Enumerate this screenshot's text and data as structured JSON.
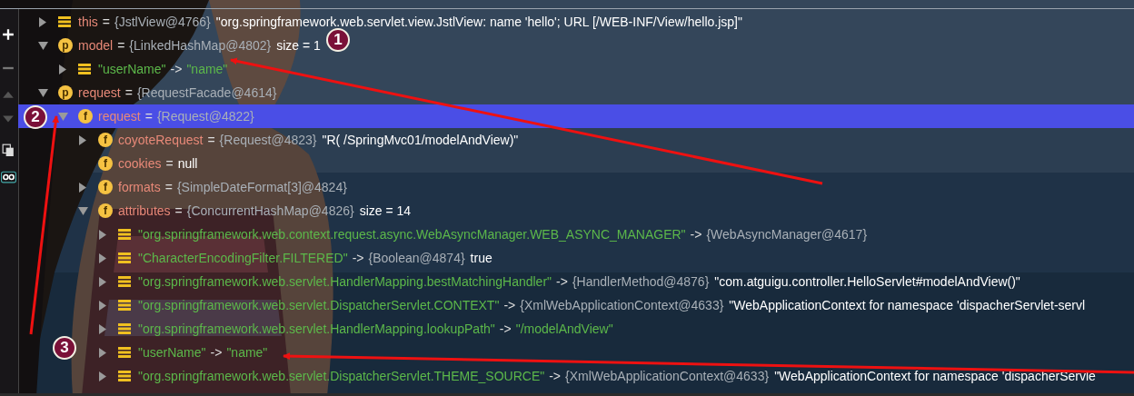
{
  "variables": [
    {
      "kind": "entry",
      "expandable": true,
      "expanded": false,
      "selected": false,
      "name": "this",
      "sep": "=",
      "type": "{JstlView@4766}",
      "value": "\"org.springframework.web.servlet.view.JstlView: name 'hello'; URL [/WEB-INF/View/hello.jsp]\"",
      "literal": false
    },
    {
      "kind": "param",
      "badge": "p",
      "expandable": true,
      "expanded": true,
      "selected": false,
      "name": "model",
      "sep": "=",
      "type": "{LinkedHashMap@4802}",
      "value": "size = 1",
      "literal": false,
      "children": [
        {
          "kind": "entry",
          "expandable": true,
          "expanded": false,
          "selected": false,
          "key": "\"userName\"",
          "sep": "->",
          "value": "\"name\"",
          "literal": true
        }
      ]
    },
    {
      "kind": "param",
      "badge": "p",
      "expandable": true,
      "expanded": true,
      "selected": false,
      "name": "request",
      "sep": "=",
      "type": "{RequestFacade@4614}",
      "children": [
        {
          "kind": "field",
          "badge": "f",
          "expandable": true,
          "expanded": true,
          "selected": true,
          "name": "request",
          "sep": "=",
          "type": "{Request@4822}",
          "children": [
            {
              "kind": "field",
              "badge": "f",
              "expandable": true,
              "expanded": false,
              "selected": false,
              "name": "coyoteRequest",
              "sep": "=",
              "type": "{Request@4823}",
              "value": "\"R( /SpringMvc01/modelAndView)\"",
              "literal": false
            },
            {
              "kind": "field",
              "badge": "f",
              "expandable": false,
              "expanded": false,
              "selected": false,
              "name": "cookies",
              "sep": "=",
              "value": "null",
              "literal": false
            },
            {
              "kind": "field",
              "badge": "f",
              "expandable": true,
              "expanded": false,
              "selected": false,
              "name": "formats",
              "sep": "=",
              "type": "{SimpleDateFormat[3]@4824}"
            },
            {
              "kind": "field",
              "badge": "f",
              "expandable": true,
              "expanded": true,
              "selected": false,
              "name": "attributes",
              "sep": "=",
              "type": "{ConcurrentHashMap@4826}",
              "value": "size = 14",
              "literal": false,
              "children": [
                {
                  "kind": "entry",
                  "expandable": true,
                  "expanded": false,
                  "selected": false,
                  "key": "\"org.springframework.web.context.request.async.WebAsyncManager.WEB_ASYNC_MANAGER\"",
                  "sep": "->",
                  "type": "{WebAsyncManager@4617}"
                },
                {
                  "kind": "entry",
                  "expandable": true,
                  "expanded": false,
                  "selected": false,
                  "key": "\"CharacterEncodingFilter.FILTERED\"",
                  "sep": "->",
                  "type": "{Boolean@4874}",
                  "value": "true",
                  "literal": false
                },
                {
                  "kind": "entry",
                  "expandable": true,
                  "expanded": false,
                  "selected": false,
                  "key": "\"org.springframework.web.servlet.HandlerMapping.bestMatchingHandler\"",
                  "sep": "->",
                  "type": "{HandlerMethod@4876}",
                  "value": "\"com.atguigu.controller.HelloServlet#modelAndView()\"",
                  "literal": false
                },
                {
                  "kind": "entry",
                  "expandable": true,
                  "expanded": false,
                  "selected": false,
                  "key": "\"org.springframework.web.servlet.DispatcherServlet.CONTEXT\"",
                  "sep": "->",
                  "type": "{XmlWebApplicationContext@4633}",
                  "value": "\"WebApplicationContext for namespace 'dispacherServlet-servl",
                  "literal": false
                },
                {
                  "kind": "entry",
                  "expandable": true,
                  "expanded": false,
                  "selected": false,
                  "key": "\"org.springframework.web.servlet.HandlerMapping.lookupPath\"",
                  "sep": "->",
                  "value": "\"/modelAndView\"",
                  "literal": true
                },
                {
                  "kind": "entry",
                  "expandable": true,
                  "expanded": false,
                  "selected": false,
                  "key": "\"userName\"",
                  "sep": "->",
                  "value": "\"name\"",
                  "literal": true
                },
                {
                  "kind": "entry",
                  "expandable": true,
                  "expanded": false,
                  "selected": false,
                  "key": "\"org.springframework.web.servlet.DispatcherServlet.THEME_SOURCE\"",
                  "sep": "->",
                  "type": "{XmlWebApplicationContext@4633}",
                  "value": "\"WebApplicationContext for namespace 'dispacherServle",
                  "literal": false
                }
              ]
            }
          ]
        }
      ]
    }
  ],
  "annotations": [
    {
      "label": "1"
    },
    {
      "label": "2"
    },
    {
      "label": "3"
    }
  ]
}
